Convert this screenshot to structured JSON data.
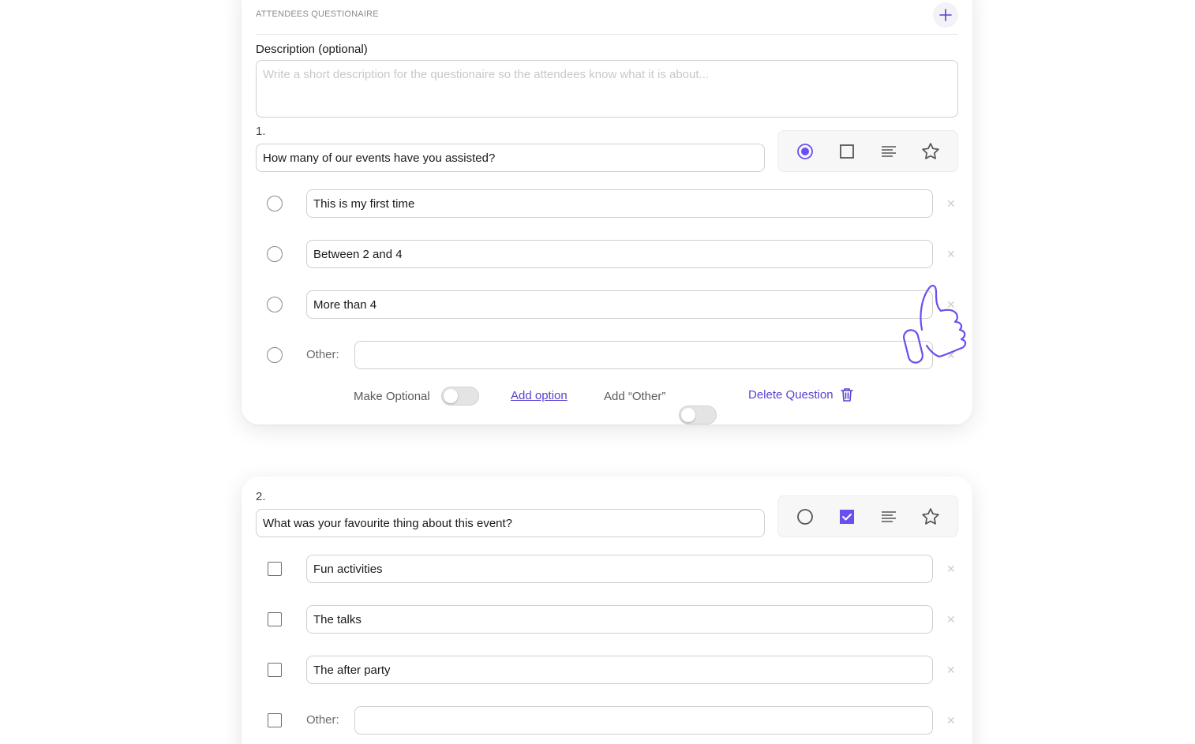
{
  "colors": {
    "accent": "#6a4ff0",
    "border": "#cfcfcf",
    "muted": "#8c8c8c"
  },
  "section": {
    "title": "ATTENDEES QUESTIONAIRE",
    "add_icon": "plus-icon",
    "description_label": "Description (optional)",
    "description_placeholder": "Write a short description for the questionaire so the attendees know what it is about..."
  },
  "questions": [
    {
      "number": "1.",
      "text": "How many of our events have you assisted?",
      "selected_type": "single-choice",
      "options": [
        "This is my first time",
        "Between 2 and 4",
        "More than 4"
      ],
      "other_label": "Other:",
      "other_value": ""
    },
    {
      "number": "2.",
      "text": "What was your favourite thing about this event?",
      "selected_type": "multiple-choice",
      "options": [
        "Fun activities",
        "The talks",
        "The after party"
      ],
      "other_label": "Other:",
      "other_value": ""
    }
  ],
  "footer": {
    "make_optional": "Make Optional",
    "make_optional_on": false,
    "add_option": "Add option",
    "add_other": "Add “Other”",
    "add_other_on": false,
    "delete_question": "Delete Question"
  },
  "remove_glyph": "✕"
}
